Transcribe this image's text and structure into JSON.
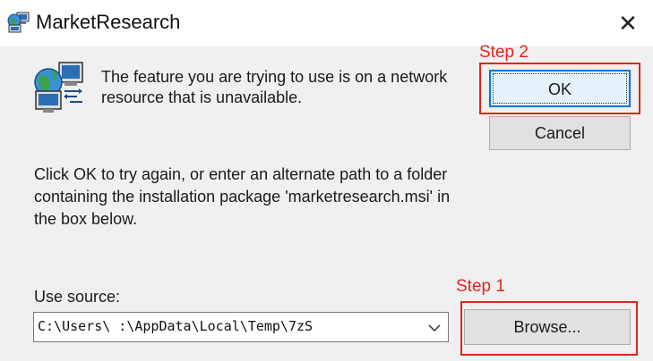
{
  "window": {
    "title": "MarketResearch",
    "close_glyph": "✕"
  },
  "icons": {
    "app": "installer-network-icon",
    "message": "network-computers-icon",
    "close": "close-icon",
    "dropdown": "chevron-down-icon"
  },
  "message": {
    "text": "The feature you are trying to use is on a network resource that is unavailable."
  },
  "instructions": {
    "text": "Click OK to try again, or enter an alternate path to a folder containing the installation package 'marketresearch.msi' in the box below."
  },
  "buttons": {
    "ok": "OK",
    "cancel": "Cancel",
    "browse": "Browse..."
  },
  "source": {
    "label": "Use source:",
    "value": "C:\\Users\\          :\\AppData\\Local\\Temp\\7zS"
  },
  "annotations": {
    "step1": "Step 1",
    "step2": "Step 2",
    "color": "#e0261c"
  },
  "colors": {
    "dialog_bg": "#f0f0f0",
    "button_bg": "#e1e1e1",
    "focus_accent": "#0078d7"
  }
}
